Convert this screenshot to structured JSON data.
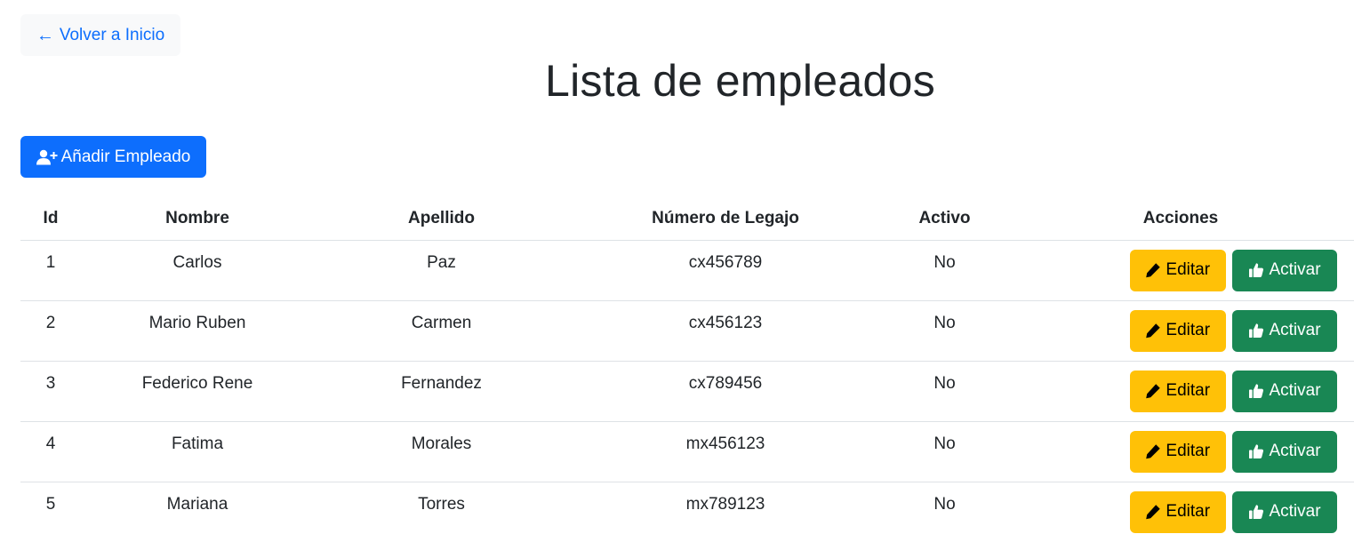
{
  "nav": {
    "back_label": "Volver a Inicio"
  },
  "page": {
    "title": "Lista de empleados"
  },
  "toolbar": {
    "add_label": "Añadir Empleado"
  },
  "table": {
    "headers": [
      "Id",
      "Nombre",
      "Apellido",
      "Número de Legajo",
      "Activo",
      "Acciones"
    ],
    "rows": [
      {
        "id": "1",
        "nombre": "Carlos",
        "apellido": "Paz",
        "legajo": "cx456789",
        "activo": "No",
        "edit_label": "Editar",
        "activate_label": "Activar"
      },
      {
        "id": "2",
        "nombre": "Mario Ruben",
        "apellido": "Carmen",
        "legajo": "cx456123",
        "activo": "No",
        "edit_label": "Editar",
        "activate_label": "Activar"
      },
      {
        "id": "3",
        "nombre": "Federico Rene",
        "apellido": "Fernandez",
        "legajo": "cx789456",
        "activo": "No",
        "edit_label": "Editar",
        "activate_label": "Activar"
      },
      {
        "id": "4",
        "nombre": "Fatima",
        "apellido": "Morales",
        "legajo": "mx456123",
        "activo": "No",
        "edit_label": "Editar",
        "activate_label": "Activar"
      },
      {
        "id": "5",
        "nombre": "Mariana",
        "apellido": "Torres",
        "legajo": "mx789123",
        "activo": "No",
        "edit_label": "Editar",
        "activate_label": "Activar"
      }
    ]
  },
  "icons": {
    "back": "arrow-left-icon",
    "add": "user-plus-icon",
    "edit": "pencil-icon",
    "activate": "thumbs-up-icon"
  },
  "colors": {
    "primary": "#0d6efd",
    "warning": "#ffc107",
    "success": "#198754",
    "light": "#f8f9fa",
    "text": "#212529"
  }
}
